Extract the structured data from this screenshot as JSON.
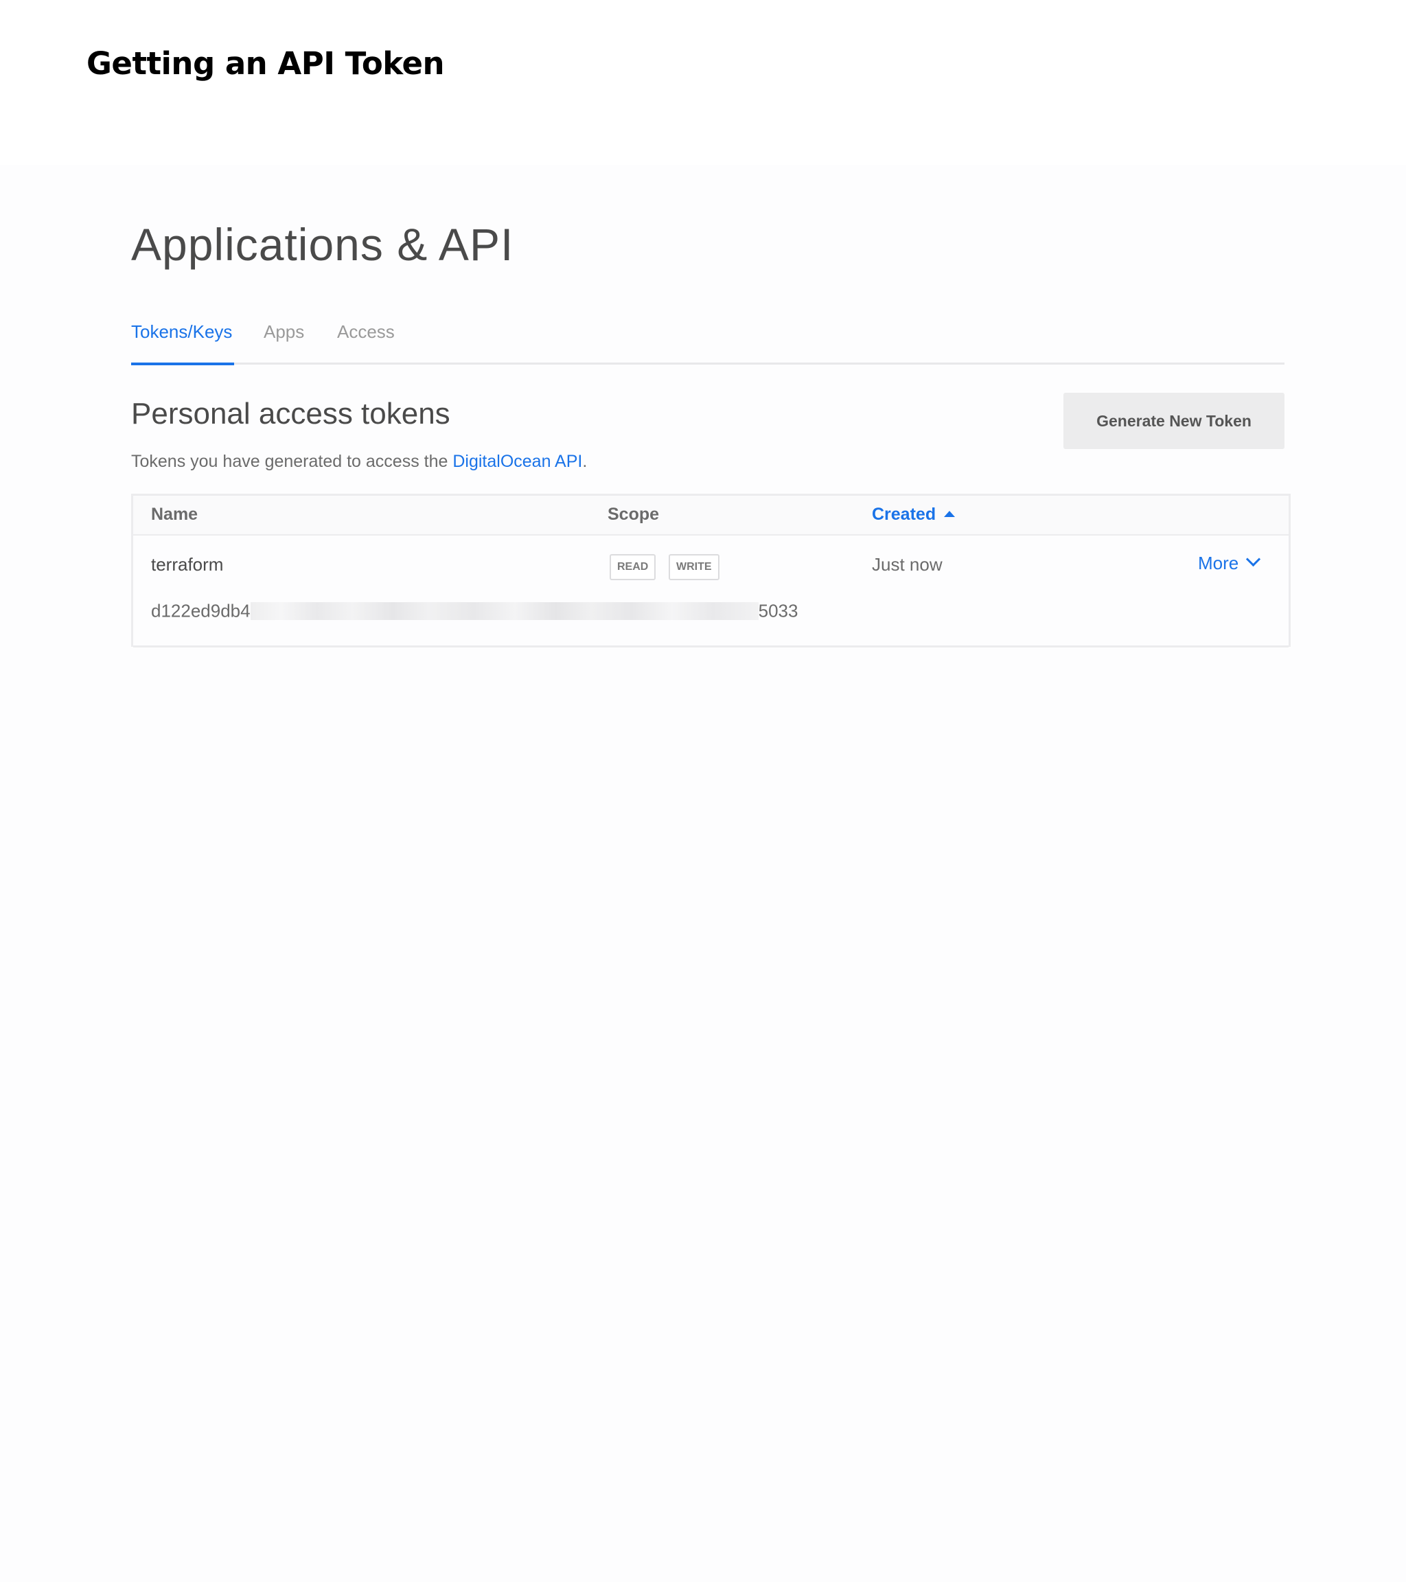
{
  "slide": {
    "title": "Getting an API Token"
  },
  "page": {
    "heading": "Applications & API"
  },
  "tabs": [
    {
      "label": "Tokens/Keys",
      "active": true
    },
    {
      "label": "Apps",
      "active": false
    },
    {
      "label": "Access",
      "active": false
    }
  ],
  "section": {
    "title": "Personal access tokens",
    "description_prefix": "Tokens you have generated to access the ",
    "description_link": "DigitalOcean API",
    "description_suffix": ".",
    "generate_button": "Generate New Token"
  },
  "table": {
    "headers": {
      "name": "Name",
      "scope": "Scope",
      "created": "Created"
    },
    "sort": {
      "column": "created",
      "direction": "ascending",
      "icon": "caret-up-icon"
    },
    "rows": [
      {
        "name": "terraform",
        "scopes": [
          "READ",
          "WRITE"
        ],
        "created": "Just now",
        "more_label": "More",
        "token_start": "d122ed9db4",
        "token_end": "5033"
      }
    ]
  },
  "colors": {
    "accent": "#1a73e8",
    "button_bg": "#ececed",
    "text": "#4a4a4a"
  },
  "icons": {
    "sort": "caret-up-icon",
    "more": "chevron-down-icon"
  }
}
